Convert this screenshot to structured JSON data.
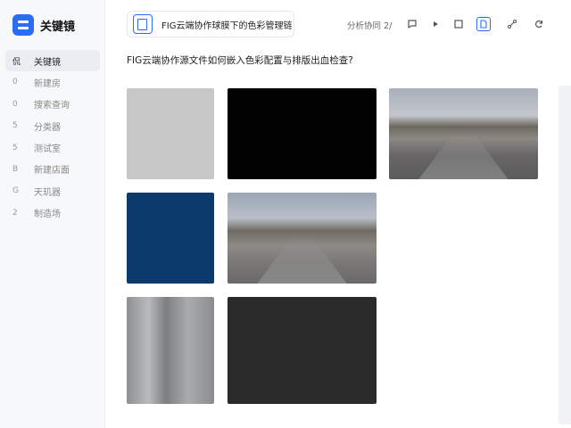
{
  "app": {
    "name": "关键镜",
    "brand_color": "#2a6cf6"
  },
  "sidebar": {
    "items": [
      {
        "icon": "侃",
        "label": "关键镜",
        "active": true
      },
      {
        "icon": "0",
        "label": "新建房"
      },
      {
        "icon": "0",
        "label": "搜索查询"
      },
      {
        "icon": "5",
        "label": "分类器"
      },
      {
        "icon": "5",
        "label": "测试室"
      },
      {
        "icon": "B",
        "label": "新建店面"
      },
      {
        "icon": "G",
        "label": "天玑器"
      },
      {
        "icon": "2",
        "label": "制造场"
      }
    ]
  },
  "topbar": {
    "doc_title": "FIG云端协作球膜下的色彩管理链",
    "share_label": "分析协同 2/",
    "tools": [
      "comment-icon",
      "play-icon",
      "frame-icon",
      "document-icon",
      "share-link-icon",
      "refresh-icon"
    ]
  },
  "main": {
    "question": "FIG云端协作源文件如何嵌入色彩配置与排版出血检查?",
    "thumbnails": [
      {
        "name": "light-gray-swatch",
        "color": "#c7c7c7"
      },
      {
        "name": "black-swatch",
        "color": "#020202"
      },
      {
        "name": "road-photo-1"
      },
      {
        "name": "navy-swatch",
        "color": "#0d3a6c"
      },
      {
        "name": "road-photo-2"
      },
      {
        "name": "blurred-building-photo"
      },
      {
        "name": "dark-gray-swatch",
        "color": "#2a2a2a"
      }
    ]
  }
}
